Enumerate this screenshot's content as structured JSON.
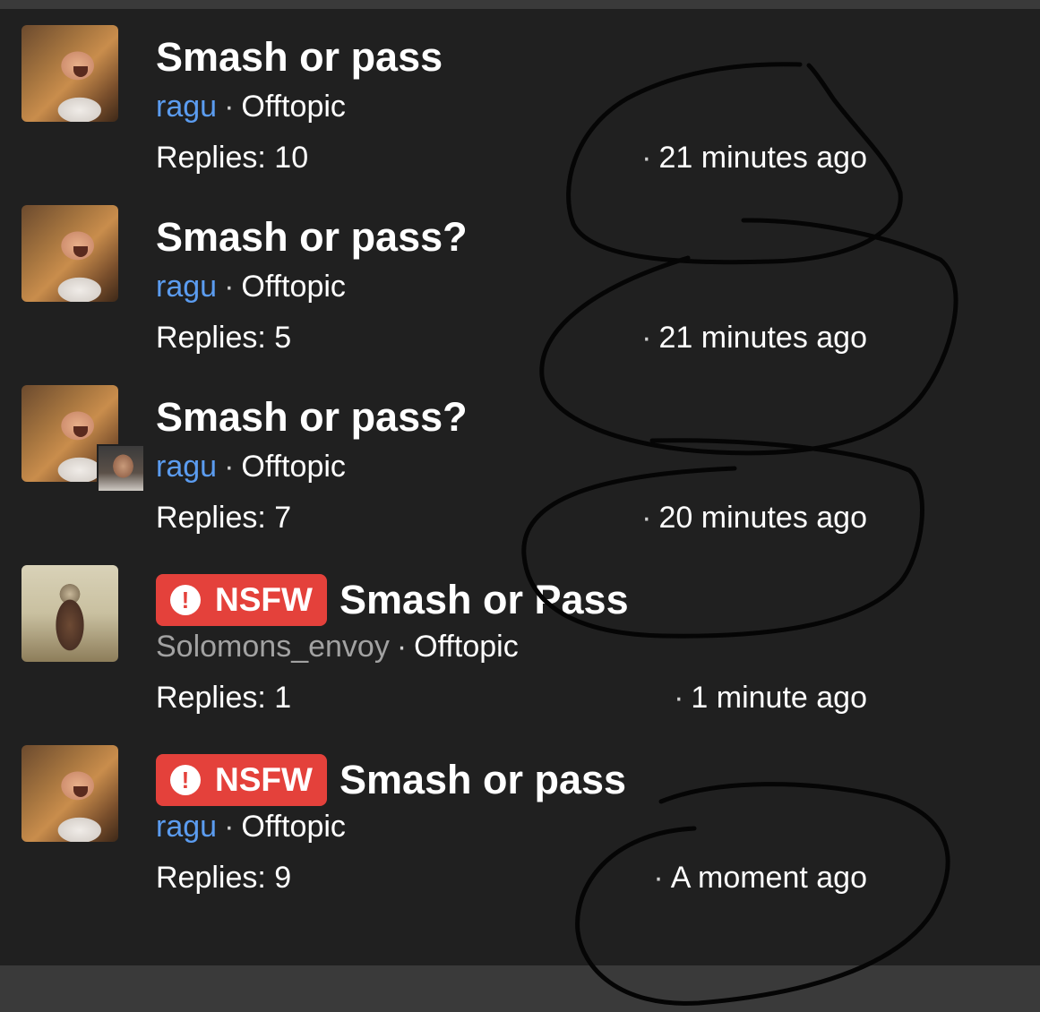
{
  "threads": [
    {
      "title": "Smash or pass",
      "nsfw": false,
      "author": "ragu",
      "separator": "·",
      "category": "Offtopic",
      "replies_label": "Replies: 10",
      "time_dot": "·",
      "time": "21 minutes ago",
      "avatar": "laughing-man-avatar"
    },
    {
      "title": "Smash or pass?",
      "nsfw": false,
      "author": "ragu",
      "separator": "·",
      "category": "Offtopic",
      "replies_label": "Replies: 5",
      "time_dot": "·",
      "time": "21 minutes ago",
      "avatar": "laughing-man-avatar"
    },
    {
      "title": "Smash or pass?",
      "nsfw": false,
      "author": "ragu",
      "separator": "·",
      "category": "Offtopic",
      "replies_label": "Replies: 7",
      "time_dot": "·",
      "time": "20 minutes ago",
      "avatar": "laughing-man-avatar",
      "secondary_avatar": "participant-avatar"
    },
    {
      "title": "Smash or Pass",
      "nsfw": true,
      "nsfw_label": "NSFW",
      "nsfw_icon": "!",
      "author": "Solomons_envoy",
      "separator": "·",
      "category": "Offtopic",
      "replies_label": "Replies: 1",
      "time_dot": "·",
      "time": "1 minute ago",
      "avatar": "robed-figure-avatar"
    },
    {
      "title": "Smash or pass",
      "nsfw": true,
      "nsfw_label": "NSFW",
      "nsfw_icon": "!",
      "author": "ragu",
      "separator": "·",
      "category": "Offtopic",
      "replies_label": "Replies: 9",
      "time_dot": "·",
      "time": "A moment ago",
      "avatar": "laughing-man-avatar"
    }
  ],
  "colors": {
    "background": "#202020",
    "author_link": "#5b9cf0",
    "author_gray": "#a2a2a2",
    "nsfw_badge": "#e4413b",
    "text": "#ffffff"
  }
}
